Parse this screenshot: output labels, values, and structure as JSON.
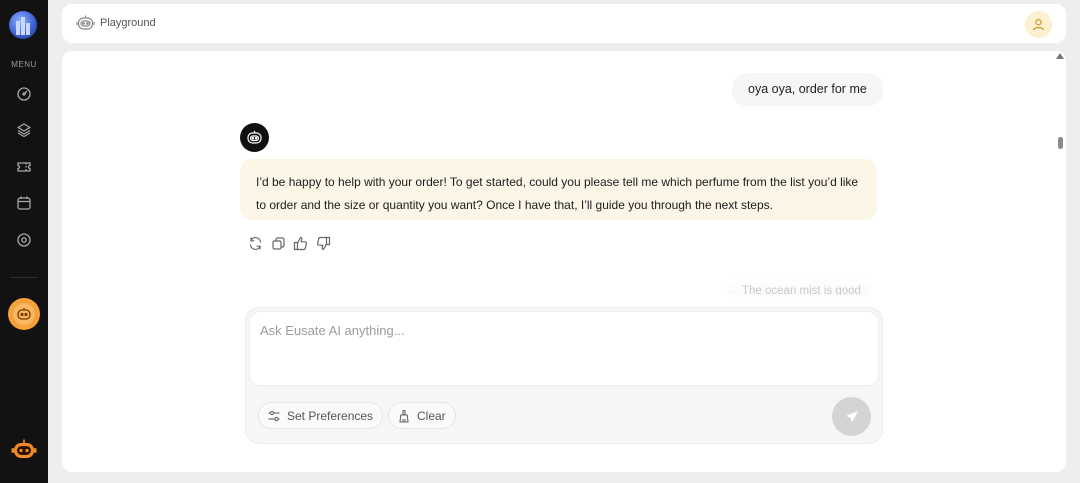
{
  "sidebar": {
    "menu_label": "MENU",
    "nav": [
      {
        "icon": "dashboard-gauge-icon"
      },
      {
        "icon": "layers-icon"
      },
      {
        "icon": "ticket-icon"
      },
      {
        "icon": "calendar-icon"
      },
      {
        "icon": "settings-circle-icon"
      }
    ],
    "active_bot_icon": "bot-icon",
    "accent_color": "#f5a03a"
  },
  "header": {
    "title": "Playground",
    "bot_icon": "bot-outline-icon",
    "user_icon": "user-icon"
  },
  "chat": {
    "messages": [
      {
        "role": "user",
        "text": "oya oya, order for me"
      },
      {
        "role": "assistant",
        "text": "I’d be happy to help with your order! To get started, could you please tell me which perfume from the list you’d like to order and the size or quantity you want? Once I have that, I’ll guide you through the next steps."
      },
      {
        "role": "user",
        "text": "The ocean mist is good"
      }
    ],
    "actions": [
      {
        "icon": "regenerate-icon"
      },
      {
        "icon": "copy-icon"
      },
      {
        "icon": "thumbs-up-icon"
      },
      {
        "icon": "thumbs-down-icon"
      }
    ]
  },
  "composer": {
    "placeholder": "Ask Eusate AI anything...",
    "value": "",
    "preferences_label": "Set Preferences",
    "clear_label": "Clear",
    "send_icon": "send-icon"
  }
}
